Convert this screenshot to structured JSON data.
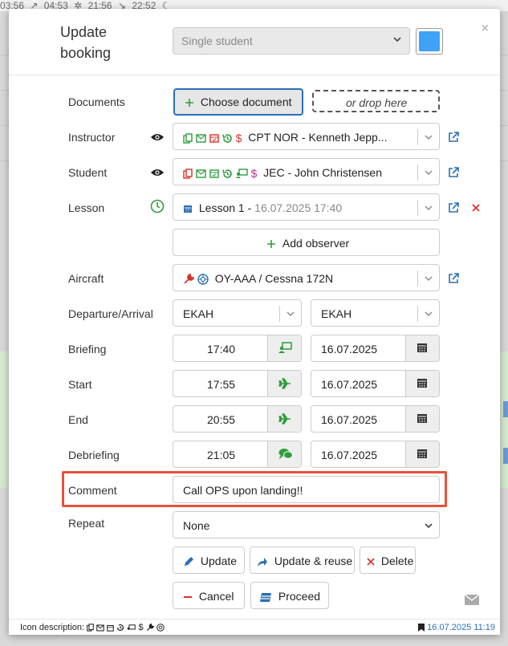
{
  "background": {
    "times": [
      "03:56",
      "04:53",
      "21:56",
      "22:52"
    ]
  },
  "modal": {
    "title_line1": "Update",
    "title_line2": "booking",
    "close_glyph": "×",
    "booking_type": "Single student",
    "color": "#3fa1f8"
  },
  "labels": {
    "documents": "Documents",
    "instructor": "Instructor",
    "student": "Student",
    "lesson": "Lesson",
    "aircraft": "Aircraft",
    "departure_arrival": "Departure/Arrival",
    "briefing": "Briefing",
    "start": "Start",
    "end": "End",
    "debriefing": "Debriefing",
    "comment": "Comment",
    "repeat": "Repeat"
  },
  "documents": {
    "choose_label": "Choose document",
    "drop_label": "or drop here"
  },
  "instructor": {
    "value": "CPT NOR - Kenneth Jepp..."
  },
  "student": {
    "value": "JEC - John Christensen"
  },
  "lesson": {
    "name": "Lesson 1 - ",
    "datetime": "16.07.2025 17:40"
  },
  "observer": {
    "add_label": "Add observer"
  },
  "aircraft": {
    "value": "OY-AAA / Cessna 172N"
  },
  "departure": {
    "value": "EKAH"
  },
  "arrival": {
    "value": "EKAH"
  },
  "briefing": {
    "time": "17:40",
    "date": "16.07.2025"
  },
  "start": {
    "time": "17:55",
    "date": "16.07.2025"
  },
  "end": {
    "time": "20:55",
    "date": "16.07.2025"
  },
  "debriefing": {
    "time": "21:05",
    "date": "16.07.2025"
  },
  "comment": {
    "value": "Call OPS upon landing!!"
  },
  "repeat": {
    "value": "None"
  },
  "buttons": {
    "update": "Update",
    "update_reuse": "Update & reuse",
    "delete": "Delete",
    "cancel": "Cancel",
    "proceed": "Proceed"
  },
  "footer": {
    "icon_description": "Icon description:",
    "timestamp": "16.07.2025 11:19"
  },
  "colors": {
    "green": "#2e9e3c",
    "red": "#d9342b",
    "blue": "#2a6fb6",
    "magenta": "#c0319b",
    "highlight": "#e8513a"
  }
}
